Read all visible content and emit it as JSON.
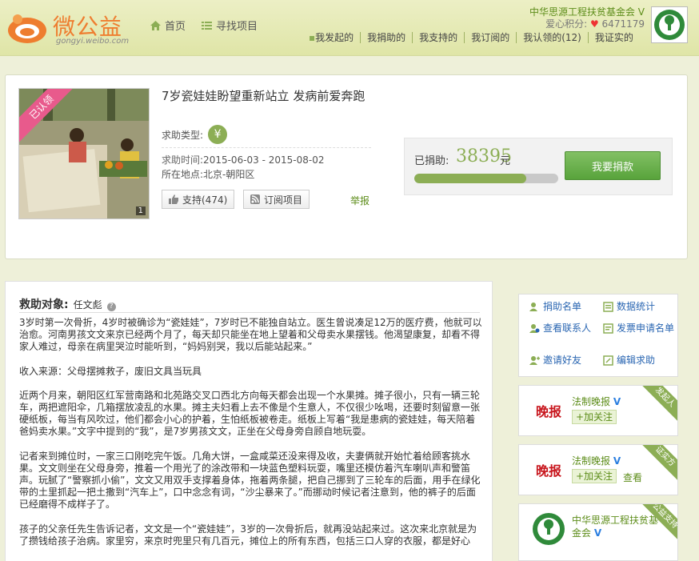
{
  "header": {
    "logo_text": "微公益",
    "logo_sub": "gongyi.weibo.com",
    "nav": [
      {
        "label": "首页",
        "icon": "home-icon"
      },
      {
        "label": "寻找项目",
        "icon": "list-icon"
      }
    ],
    "user": {
      "name": "中华思源工程扶贫基金会",
      "verified_mark": "V",
      "points_label": "爱心积分:",
      "points_value": "6471179"
    },
    "subnav": [
      "我发起的",
      "我捐助的",
      "我支持的",
      "我订阅的",
      "我认领的(12)",
      "我证实的"
    ]
  },
  "project": {
    "ribbon": "已认领",
    "photo_count": "1",
    "title": "7岁瓷娃娃盼望重新站立 发病前爱奔跑",
    "type_label": "求助类型:",
    "type_icon": "yen-icon",
    "time_label": "求助时间",
    "time_value": ":2015-06-03 - 2015-08-02",
    "location_label": "所在地点",
    "location_value": ":北京-朝阳区",
    "support_label": "支持(474)",
    "subscribe_label": "订阅项目",
    "report_label": "举报",
    "raised_label": "已捐助:",
    "raised_amount": "38395",
    "raised_unit": "元",
    "progress_fraction": 0.78,
    "donate_button": "我要捐款"
  },
  "main": {
    "target_label": "救助对象:",
    "target_name": "任文彪",
    "paragraphs": [
      "3岁时第一次骨折，4岁时被确诊为“瓷娃娃”，7岁时已不能独自站立。医生曾说凑足12万的医疗费，他就可以治愈。河南男孩文文来京已经两个月了，每天却只能坐在地上望着和父母卖水果摆钱。他渴望康复，却看不得家人难过，母亲在病里哭泣时能听到，“妈妈别哭，我以后能站起来。”",
      "收入来源：父母摆摊救子，废旧文具当玩具",
      "近两个月来，朝阳区红军营南路和北苑路交叉口西北方向每天都会出现一个水果摊。摊子很小，只有一辆三轮车，两把遮阳伞，几箱摆放凌乱的水果。摊主夫妇看上去不像是个生意人，不仅很少吆喝，还要时刻留意一张硬纸板，每当有风吹过，他们都会小心的护着，生怕纸板被卷走。纸板上写着“我是患病的瓷娃娃，每天陪着爸妈卖水果。”文字中提到的“我”，是7岁男孩文文，正坐在父母身旁自顾自地玩耍。",
      "记者来到摊位时，一家三口刚吃完午饭。几角大饼，一盒咸菜还没来得及收，夫妻俩就开始忙着给顾客挑水果。文文则坐在父母身旁，推着一个用光了的涂改带和一块蓝色塑料玩耍，嘴里还模仿着汽车喇叭声和警笛声。玩腻了“警察抓小偷”，文文又用双手支撑着身体，拖着两条腿，把自己挪到了三轮车的后面，用手在绿化带的土里抓起一把土撒到“汽车上”，口中念念有词，“沙尘暴来了。”而挪动时候记者注意到，他的裤子的后面已经磨得不成样子了。",
      "孩子的父亲任先生告诉记者，文文是一个“瓷娃娃”，3岁的一次骨折后，就再没站起来过。这次来北京就是为了攒钱给孩子治病。家里穷，来京时兜里只有几百元，摊位上的所有东西，包括三口人穿的衣服，都是好心"
    ]
  },
  "sidebar": {
    "menu": [
      {
        "label": "捐助名单",
        "icon": "donor-list-icon"
      },
      {
        "label": "数据统计",
        "icon": "stats-icon"
      },
      {
        "label": "查看联系人",
        "icon": "contacts-icon"
      },
      {
        "label": "发票申请名单",
        "icon": "invoice-icon"
      },
      {
        "label": "邀请好友",
        "icon": "invite-icon"
      },
      {
        "label": "编辑求助",
        "icon": "edit-icon"
      }
    ],
    "cards": [
      {
        "name": "法制晚报",
        "logo": "晚报",
        "follow": "+加关注",
        "view": "",
        "corner": "发起人"
      },
      {
        "name": "法制晚报",
        "logo": "晚报",
        "follow": "+加关注",
        "view": "查看",
        "corner": "证实方"
      },
      {
        "name": "中华思源工程扶贫基金会",
        "logo": "",
        "follow": "",
        "view": "",
        "corner": "公益支持"
      }
    ]
  },
  "colors": {
    "brand_green": "#8cae55",
    "link_blue": "#2a66b2",
    "ribbon_pink": "#e85a8c"
  }
}
